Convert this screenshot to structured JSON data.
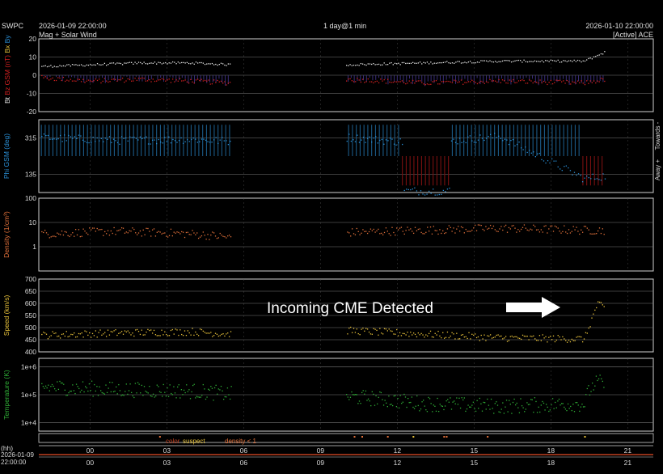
{
  "header": {
    "product": "SWPC",
    "start_time": "2026-01-09 22:00:00",
    "span": "1 day@1 min",
    "end_time": "2026-01-10 22:00:00",
    "subtitle": "Mag + Solar Wind",
    "source": "[Active] ACE"
  },
  "annotation": "Incoming CME Detected",
  "legend": {
    "color": "color",
    "suspect": "suspect",
    "density": "density < 1"
  },
  "time_axis": {
    "unit_label": "(hh)",
    "date_label": "2026-01-09",
    "time_label": "22:00:00",
    "ticks": [
      "00",
      "03",
      "06",
      "09",
      "12",
      "15",
      "18",
      "21"
    ]
  },
  "colors": {
    "bt": "#e8e8e8",
    "bz": "#d42020",
    "phi": "#2a8fd6",
    "phi_fill": "#1b5a86",
    "away_fill": "#7a1010",
    "bz_south_fill": "#3a2e78",
    "density": "#e0703a",
    "speed": "#e8c23a",
    "temperature": "#2fae36",
    "grid": "#7a7a7a",
    "frame": "#cfcfcf"
  },
  "chart_data": [
    {
      "type": "scatter",
      "panel": "mag",
      "ylabel_parts": [
        "Bt",
        "Bz GSM (nT)",
        "Bx",
        "By"
      ],
      "ylim": [
        -20,
        20
      ],
      "yticks": [
        "20",
        "10",
        "0",
        "-10",
        "-20"
      ],
      "x": [
        0,
        2,
        4,
        6,
        7.5,
        9,
        12,
        15,
        18,
        21.3,
        22.1
      ],
      "series": [
        {
          "name": "Bt",
          "values": [
            5,
            6,
            7,
            7,
            6,
            null,
            6,
            7,
            8,
            8,
            13
          ]
        },
        {
          "name": "Bz GSM",
          "values": [
            -1,
            -3,
            -2,
            -3,
            -4,
            null,
            -2,
            -4,
            -3,
            -4,
            -2
          ]
        }
      ]
    },
    {
      "type": "scatter",
      "panel": "phi",
      "ylabel": "Phi GSM (deg)",
      "right_labels": [
        "Towards -",
        "Away +"
      ],
      "ylim": [
        45,
        405
      ],
      "yticks": [
        "315",
        "135"
      ],
      "x": [
        0,
        3,
        6,
        7.5,
        9,
        12,
        15,
        18,
        21.3,
        22.1
      ],
      "series": [
        {
          "name": "Phi GSM",
          "values": [
            320,
            305,
            310,
            300,
            null,
            320,
            290,
            325,
            115,
            130
          ]
        }
      ]
    },
    {
      "type": "scatter",
      "panel": "density",
      "ylabel": "Density (1/cm³)",
      "ylim": [
        0.1,
        100
      ],
      "scale": "log",
      "yticks": [
        "100",
        "10",
        "1"
      ],
      "x": [
        0,
        3,
        6,
        7.5,
        9,
        12,
        15,
        18,
        21.3,
        22.1
      ],
      "series": [
        {
          "name": "Density",
          "values": [
            3.5,
            4.5,
            3.5,
            2.5,
            null,
            4,
            5,
            6,
            5,
            5
          ]
        }
      ]
    },
    {
      "type": "scatter",
      "panel": "speed",
      "ylabel": "Speed (km/s)",
      "ylim": [
        400,
        700
      ],
      "yticks": [
        "700",
        "650",
        "600",
        "550",
        "500",
        "450",
        "400"
      ],
      "x": [
        0,
        3,
        6,
        7.5,
        9,
        12,
        15,
        18,
        21.3,
        21.8,
        22.1
      ],
      "series": [
        {
          "name": "Speed",
          "values": [
            470,
            480,
            485,
            475,
            null,
            490,
            475,
            460,
            455,
            600,
            580
          ]
        }
      ]
    },
    {
      "type": "scatter",
      "panel": "temperature",
      "ylabel": "Temperature (K)",
      "ylim": [
        5000,
        2000000
      ],
      "scale": "log",
      "yticks": [
        "1e+6",
        "1e+5",
        "1e+4"
      ],
      "x": [
        0,
        3,
        6,
        7.5,
        9,
        12,
        15,
        18,
        21.3,
        21.8,
        22.1
      ],
      "series": [
        {
          "name": "Temperature",
          "values": [
            200000,
            160000,
            140000,
            110000,
            null,
            90000,
            50000,
            40000,
            50000,
            300000,
            250000
          ]
        }
      ]
    }
  ]
}
